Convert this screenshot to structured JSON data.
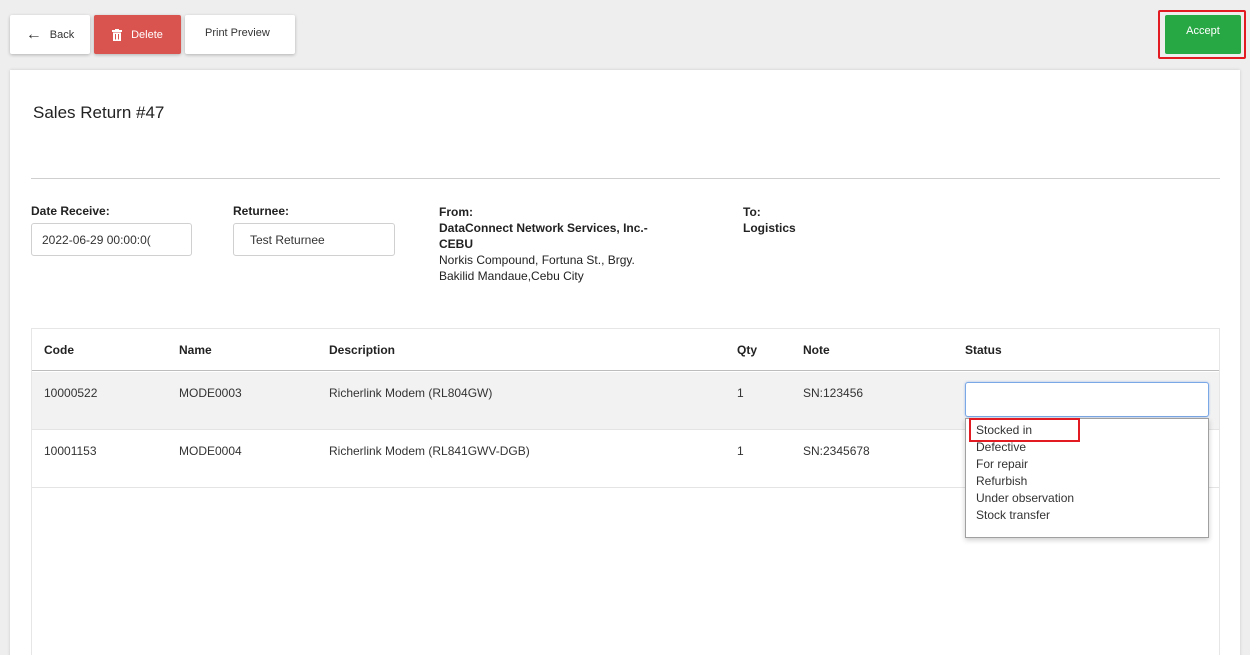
{
  "toolbar": {
    "back_label": "Back",
    "delete_label": "Delete",
    "print_label": "Print Preview",
    "accept_label": "Accept"
  },
  "page": {
    "title": "Sales Return #47"
  },
  "fields": {
    "date_label": "Date Receive:",
    "date_value": "2022-06-29 00:00:0(",
    "returnee_label": "Returnee:",
    "returnee_value": "Test Returnee",
    "from_label": "From:",
    "from_name": "DataConnect Network Services, Inc.-",
    "from_name2": "CEBU",
    "from_addr1": "Norkis Compound, Fortuna St., Brgy.",
    "from_addr2": "Bakilid Mandaue,Cebu City",
    "to_label": "To:",
    "to_value": "Logistics"
  },
  "table": {
    "headers": [
      "Code",
      "Name",
      "Description",
      "Qty",
      "Note",
      "Status"
    ],
    "rows": [
      {
        "code": "10000522",
        "name": "MODE0003",
        "description": "Richerlink Modem (RL804GW)",
        "qty": "1",
        "note": "SN:123456"
      },
      {
        "code": "10001153",
        "name": "MODE0004",
        "description": "Richerlink Modem (RL841GWV-DGB)",
        "qty": "1",
        "note": "SN:2345678"
      }
    ]
  },
  "status_dropdown": {
    "options": [
      "Stocked in",
      "Defective",
      "For repair",
      "Refurbish",
      "Under observation",
      "Stock transfer"
    ]
  },
  "colors": {
    "delete": "#d9534f",
    "accept": "#28a745",
    "highlight": "#e21a22"
  }
}
